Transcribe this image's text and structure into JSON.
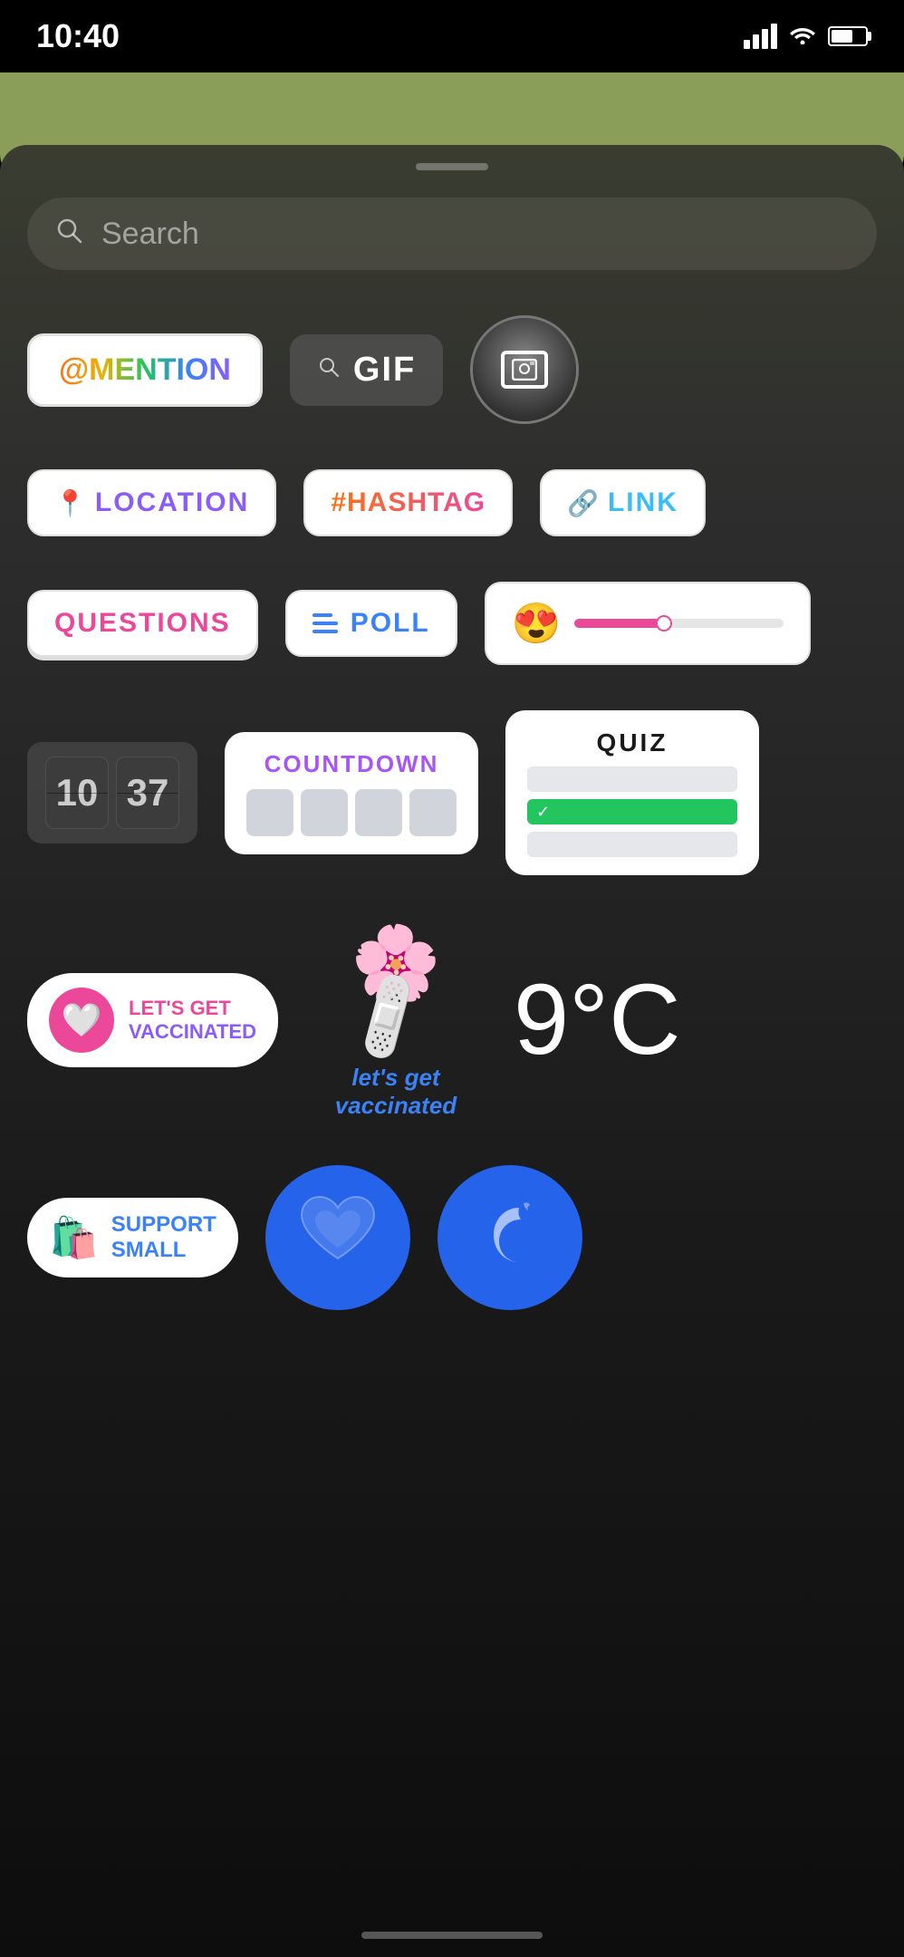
{
  "statusBar": {
    "time": "10:40",
    "signal": "signal-icon",
    "wifi": "wifi-icon",
    "battery": "battery-icon"
  },
  "search": {
    "placeholder": "Search"
  },
  "stickers": {
    "row1": [
      {
        "id": "mention",
        "label": "@MENTION"
      },
      {
        "id": "gif",
        "label": "GIF"
      },
      {
        "id": "photo",
        "label": "photo"
      }
    ],
    "row2": [
      {
        "id": "location",
        "label": "LOCATION"
      },
      {
        "id": "hashtag",
        "label": "#HASHTAG"
      },
      {
        "id": "link",
        "label": "LINK"
      }
    ],
    "row3": [
      {
        "id": "questions",
        "label": "QUESTIONS"
      },
      {
        "id": "poll",
        "label": "POLL"
      },
      {
        "id": "emoji-slider",
        "label": ""
      }
    ],
    "row4": [
      {
        "id": "flipclock",
        "digits": [
          "10",
          "37"
        ]
      },
      {
        "id": "countdown",
        "label": "COUNTDOWN"
      },
      {
        "id": "quiz",
        "label": "QUIZ"
      }
    ],
    "row5": [
      {
        "id": "vaccine-badge",
        "label": "LET'S GET VACCINATED"
      },
      {
        "id": "vaccine-art",
        "label": "let's get vaccinated"
      },
      {
        "id": "temperature",
        "value": "9°C"
      }
    ],
    "row6": [
      {
        "id": "support-small",
        "label": "SUPPORT SMALL"
      },
      {
        "id": "blue-heart",
        "label": ""
      },
      {
        "id": "moon",
        "label": ""
      }
    ]
  }
}
